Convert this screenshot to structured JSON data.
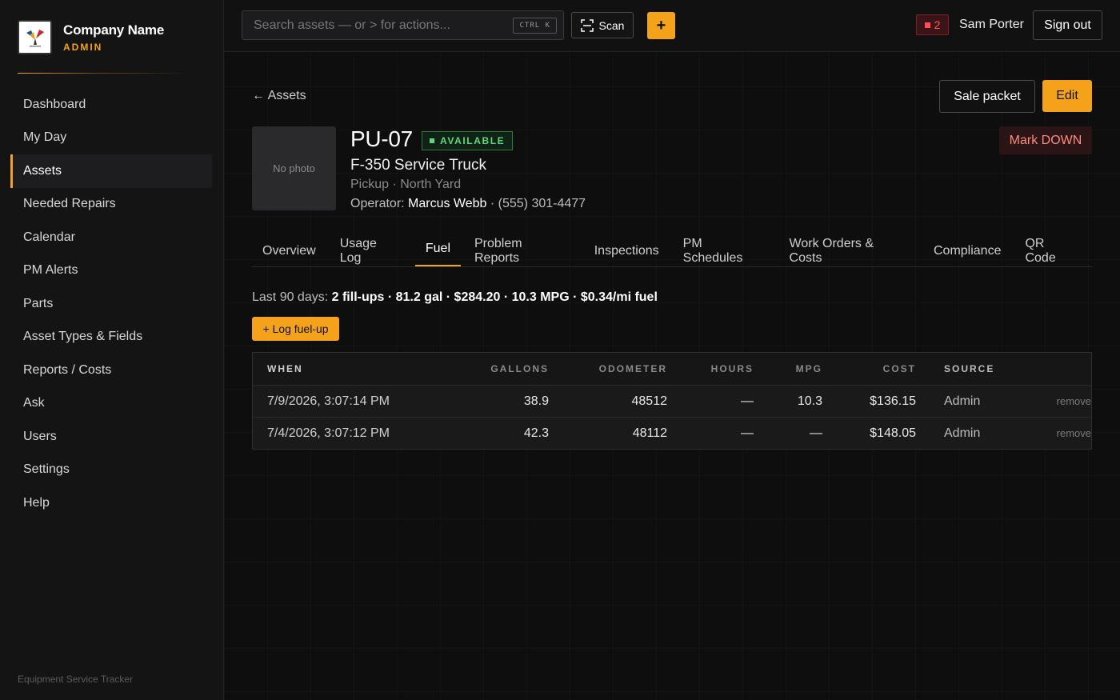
{
  "brand": {
    "name": "Company Name",
    "role": "ADMIN"
  },
  "sidebar": {
    "items": [
      {
        "label": "Dashboard"
      },
      {
        "label": "My Day"
      },
      {
        "label": "Assets"
      },
      {
        "label": "Needed Repairs"
      },
      {
        "label": "Calendar"
      },
      {
        "label": "PM Alerts"
      },
      {
        "label": "Parts"
      },
      {
        "label": "Asset Types & Fields"
      },
      {
        "label": "Reports / Costs"
      },
      {
        "label": "Ask"
      },
      {
        "label": "Users"
      },
      {
        "label": "Settings"
      },
      {
        "label": "Help"
      }
    ],
    "active": "Assets",
    "footer": "Equipment Service Tracker"
  },
  "topbar": {
    "search_placeholder": "Search assets — or > for actions...",
    "shortcut": "CTRL K",
    "scan_label": "Scan",
    "plus_label": "+",
    "alert_count": "2",
    "user_name": "Sam Porter",
    "signout_label": "Sign out"
  },
  "asset": {
    "back_label": "← Assets",
    "photo_placeholder": "No photo",
    "id": "PU-07",
    "status": "AVAILABLE",
    "model": "F-350 Service Truck",
    "subline": "Pickup · North Yard",
    "operator_prefix": "Operator: ",
    "operator_name": "Marcus Webb",
    "operator_phone": " · (555) 301-4477",
    "sale_packet_label": "Sale packet",
    "edit_label": "Edit",
    "mark_down_label": "Mark DOWN"
  },
  "tabs": [
    {
      "label": "Overview"
    },
    {
      "label": "Usage Log"
    },
    {
      "label": "Fuel"
    },
    {
      "label": "Problem Reports"
    },
    {
      "label": "Inspections"
    },
    {
      "label": "PM Schedules"
    },
    {
      "label": "Work Orders & Costs"
    },
    {
      "label": "Compliance"
    },
    {
      "label": "QR Code"
    }
  ],
  "active_tab": "Fuel",
  "fuel": {
    "summary_prefix": "Last 90 days: ",
    "summary_stats": "2 fill-ups · 81.2 gal · $284.20 · 10.3 MPG · $0.34/mi fuel",
    "log_button": "+ Log fuel-up",
    "columns": [
      "WHEN",
      "GALLONS",
      "ODOMETER",
      "HOURS",
      "MPG",
      "COST",
      "SOURCE"
    ],
    "rows": [
      {
        "when": "7/9/2026, 3:07:14 PM",
        "gallons": "38.9",
        "odometer": "48512",
        "hours": "—",
        "mpg": "10.3",
        "cost": "$136.15",
        "source": "Admin",
        "action": "remove"
      },
      {
        "when": "7/4/2026, 3:07:12 PM",
        "gallons": "42.3",
        "odometer": "48112",
        "hours": "—",
        "mpg": "—",
        "cost": "$148.05",
        "source": "Admin",
        "action": "remove"
      }
    ]
  },
  "colors": {
    "accent": "#f5a21b",
    "available": "#59d97a",
    "alert": "#ff4d52",
    "markdown": "#ff8a7a"
  }
}
